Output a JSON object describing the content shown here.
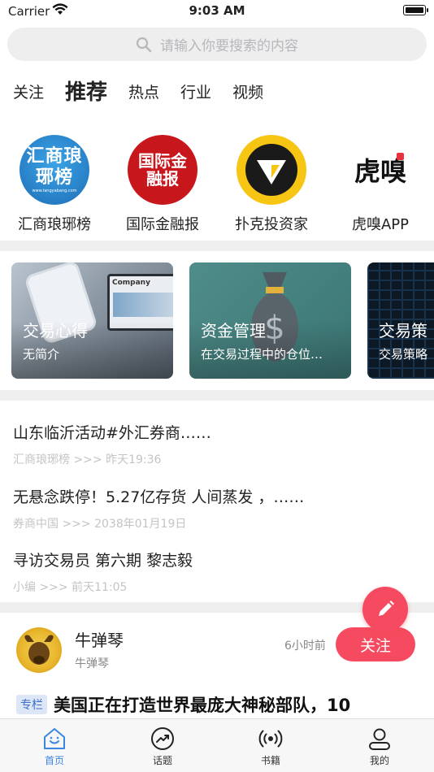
{
  "status_bar": {
    "carrier": "Carrier",
    "time": "9:03 AM"
  },
  "search": {
    "placeholder": "请输入你要搜索的内容"
  },
  "tabs": [
    {
      "label": "关注",
      "active": false
    },
    {
      "label": "推荐",
      "active": true
    },
    {
      "label": "热点",
      "active": false
    },
    {
      "label": "行业",
      "active": false
    },
    {
      "label": "视频",
      "active": false
    }
  ],
  "media": [
    {
      "name": "汇商琅琊榜",
      "logo_text": "汇商琅琊榜",
      "logo_sub": "www.langyabang.com"
    },
    {
      "name": "国际金融报",
      "logo_text": "国际金融报"
    },
    {
      "name": "扑克投资家",
      "logo_text": ""
    },
    {
      "name": "虎嗅APP",
      "logo_text": "虎嗅"
    }
  ],
  "cards": [
    {
      "title": "交易心得",
      "desc": "无简介",
      "image_text": "Company"
    },
    {
      "title": "资金管理",
      "desc": "在交易过程中的仓位…"
    },
    {
      "title": "交易策",
      "desc": "交易策略"
    }
  ],
  "news": [
    {
      "title": "山东临沂活动#外汇券商……",
      "source": "汇商琅琊榜",
      "sep": ">>>",
      "time": "昨天19:36"
    },
    {
      "title": "无悬念跌停！5.27亿存货 人间蒸发 ，……",
      "source": "券商中国",
      "sep": ">>>",
      "time": "2038年01月19日"
    },
    {
      "title": "寻访交易员 第六期 黎志毅",
      "source": "小编",
      "sep": ">>>",
      "time": "前天11:05"
    }
  ],
  "post": {
    "name": "牛弹琴",
    "subtitle": "牛弹琴",
    "time": "6小时前",
    "follow_label": "关注",
    "tag": "专栏",
    "headline": "美国正在打造世界最庞大神秘部队，10"
  },
  "tabbar": [
    {
      "label": "首页",
      "icon": "home-icon",
      "active": true
    },
    {
      "label": "话题",
      "icon": "trend-icon",
      "active": false
    },
    {
      "label": "书籍",
      "icon": "broadcast-icon",
      "active": false
    },
    {
      "label": "我的",
      "icon": "user-icon",
      "active": false
    }
  ],
  "colors": {
    "accent": "#f54a5f",
    "tab_active": "#3a86e0",
    "divider": "#efefef"
  }
}
